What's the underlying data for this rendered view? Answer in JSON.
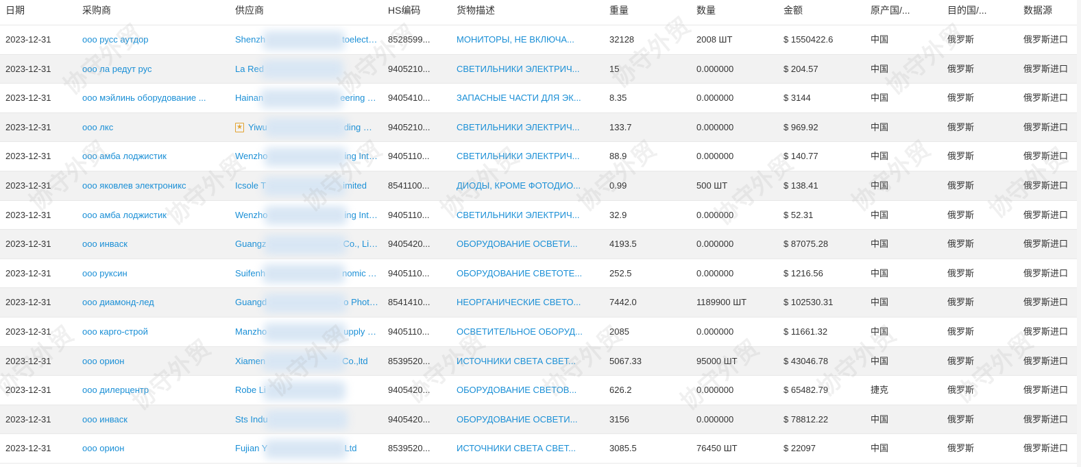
{
  "columns": [
    "日期",
    "采购商",
    "供应商",
    "HS编码",
    "货物描述",
    "重量",
    "数量",
    "金额",
    "原产国/...",
    "目的国/...",
    "数据源"
  ],
  "watermark": "协守外贸",
  "colors": {
    "link": "#1a8fd6",
    "row_alt": "#f2f2f2",
    "border": "#e8e8e8"
  },
  "rows": [
    {
      "date": "2023-12-31",
      "buyer": "ооо русс аутдор",
      "supplier_prefix": "Shenzh",
      "supplier_suffix": "toelectro...",
      "hs": "8528599...",
      "desc": "МОНИТОРЫ, НЕ ВКЛЮЧА...",
      "weight": "32128",
      "qty": "2008 ШТ",
      "amount": "$ 1550422.6",
      "origin": "中国",
      "dest": "俄罗斯",
      "source": "俄罗斯进口",
      "supplier_icon": false
    },
    {
      "date": "2023-12-31",
      "buyer": "ооо ла редут рус",
      "supplier_prefix": "La Red",
      "supplier_suffix": "",
      "hs": "9405210...",
      "desc": "СВЕТИЛЬНИКИ ЭЛЕКТРИЧ...",
      "weight": "15",
      "qty": "0.000000",
      "amount": "$ 204.57",
      "origin": "中国",
      "dest": "俄罗斯",
      "source": "俄罗斯进口",
      "supplier_icon": false
    },
    {
      "date": "2023-12-31",
      "buyer": "ооо мэйлинь оборудование ...",
      "supplier_prefix": "Hainan",
      "supplier_suffix": "eering Te...",
      "hs": "9405410...",
      "desc": "ЗАПАСНЫЕ ЧАСТИ ДЛЯ ЭК...",
      "weight": "8.35",
      "qty": "0.000000",
      "amount": "$ 3144",
      "origin": "中国",
      "dest": "俄罗斯",
      "source": "俄罗斯进口",
      "supplier_icon": false
    },
    {
      "date": "2023-12-31",
      "buyer": "ооо лкс",
      "supplier_prefix": "Yiwu",
      "supplier_suffix": "ding Co.,...",
      "hs": "9405210...",
      "desc": "СВЕТИЛЬНИКИ ЭЛЕКТРИЧ...",
      "weight": "133.7",
      "qty": "0.000000",
      "amount": "$ 969.92",
      "origin": "中国",
      "dest": "俄罗斯",
      "source": "俄罗斯进口",
      "supplier_icon": true
    },
    {
      "date": "2023-12-31",
      "buyer": "ооо амба лоджистик",
      "supplier_prefix": "Wenzho",
      "supplier_suffix": "ing Intern...",
      "hs": "9405110...",
      "desc": "СВЕТИЛЬНИКИ ЭЛЕКТРИЧ...",
      "weight": "88.9",
      "qty": "0.000000",
      "amount": "$ 140.77",
      "origin": "中国",
      "dest": "俄罗斯",
      "source": "俄罗斯进口",
      "supplier_icon": false
    },
    {
      "date": "2023-12-31",
      "buyer": "ооо яковлев электроникс",
      "supplier_prefix": "Icsole T",
      "supplier_suffix": "imited",
      "hs": "8541100...",
      "desc": "ДИОДЫ, КРОМЕ ФОТОДИО...",
      "weight": "0.99",
      "qty": "500 ШТ",
      "amount": "$ 138.41",
      "origin": "中国",
      "dest": "俄罗斯",
      "source": "俄罗斯进口",
      "supplier_icon": false
    },
    {
      "date": "2023-12-31",
      "buyer": "ооо амба лоджистик",
      "supplier_prefix": "Wenzho",
      "supplier_suffix": "ing Intern...",
      "hs": "9405110...",
      "desc": "СВЕТИЛЬНИКИ ЭЛЕКТРИЧ...",
      "weight": "32.9",
      "qty": "0.000000",
      "amount": "$ 52.31",
      "origin": "中国",
      "dest": "俄罗斯",
      "source": "俄罗斯进口",
      "supplier_icon": false
    },
    {
      "date": "2023-12-31",
      "buyer": "ооо инваск",
      "supplier_prefix": "Guangz",
      "supplier_suffix": "Co., Limited",
      "hs": "9405420...",
      "desc": "ОБОРУДОВАНИЕ ОСВЕТИ...",
      "weight": "4193.5",
      "qty": "0.000000",
      "amount": "$ 87075.28",
      "origin": "中国",
      "dest": "俄罗斯",
      "source": "俄罗斯进口",
      "supplier_icon": false
    },
    {
      "date": "2023-12-31",
      "buyer": "ооо руксин",
      "supplier_prefix": "Suifenh",
      "supplier_suffix": "nomic A...",
      "hs": "9405110...",
      "desc": "ОБОРУДОВАНИЕ СВЕТОТЕ...",
      "weight": "252.5",
      "qty": "0.000000",
      "amount": "$ 1216.56",
      "origin": "中国",
      "dest": "俄罗斯",
      "source": "俄罗斯进口",
      "supplier_icon": false
    },
    {
      "date": "2023-12-31",
      "buyer": "ооо диамонд-лед",
      "supplier_prefix": "Guangd",
      "supplier_suffix": "o Photoe...",
      "hs": "8541410...",
      "desc": "НЕОРГАНИЧЕСКИЕ СВЕТО...",
      "weight": "7442.0",
      "qty": "1189900 ШТ",
      "amount": "$ 102530.31",
      "origin": "中国",
      "dest": "俄罗斯",
      "source": "俄罗斯进口",
      "supplier_icon": false
    },
    {
      "date": "2023-12-31",
      "buyer": "ооо карго-строй",
      "supplier_prefix": "Manzho",
      "supplier_suffix": "upply Ch...",
      "hs": "9405110...",
      "desc": "ОСВЕТИТЕЛЬНОЕ ОБОРУД...",
      "weight": "2085",
      "qty": "0.000000",
      "amount": "$ 11661.32",
      "origin": "中国",
      "dest": "俄罗斯",
      "source": "俄罗斯进口",
      "supplier_icon": false
    },
    {
      "date": "2023-12-31",
      "buyer": "ооо орион",
      "supplier_prefix": "Xiamen",
      "supplier_suffix": "Co.,ltd",
      "hs": "8539520...",
      "desc": "ИСТОЧНИКИ СВЕТА СВЕТ...",
      "weight": "5067.33",
      "qty": "95000 ШТ",
      "amount": "$ 43046.78",
      "origin": "中国",
      "dest": "俄罗斯",
      "source": "俄罗斯进口",
      "supplier_icon": false
    },
    {
      "date": "2023-12-31",
      "buyer": "ооо дилерцентр",
      "supplier_prefix": "Robe Li",
      "supplier_suffix": "",
      "hs": "9405420...",
      "desc": "ОБОРУДОВАНИЕ СВЕТОВ...",
      "weight": "626.2",
      "qty": "0.000000",
      "amount": "$ 65482.79",
      "origin": "捷克",
      "dest": "俄罗斯",
      "source": "俄罗斯进口",
      "supplier_icon": false
    },
    {
      "date": "2023-12-31",
      "buyer": "ооо инваск",
      "supplier_prefix": "Sts Indu",
      "supplier_suffix": "",
      "hs": "9405420...",
      "desc": "ОБОРУДОВАНИЕ ОСВЕТИ...",
      "weight": "3156",
      "qty": "0.000000",
      "amount": "$ 78812.22",
      "origin": "中国",
      "dest": "俄罗斯",
      "source": "俄罗斯进口",
      "supplier_icon": false
    },
    {
      "date": "2023-12-31",
      "buyer": "ооо орион",
      "supplier_prefix": "Fujian Y",
      "supplier_suffix": "Ltd",
      "hs": "8539520...",
      "desc": "ИСТОЧНИКИ СВЕТА СВЕТ...",
      "weight": "3085.5",
      "qty": "76450 ШТ",
      "amount": "$ 22097",
      "origin": "中国",
      "dest": "俄罗斯",
      "source": "俄罗斯进口",
      "supplier_icon": false
    }
  ]
}
